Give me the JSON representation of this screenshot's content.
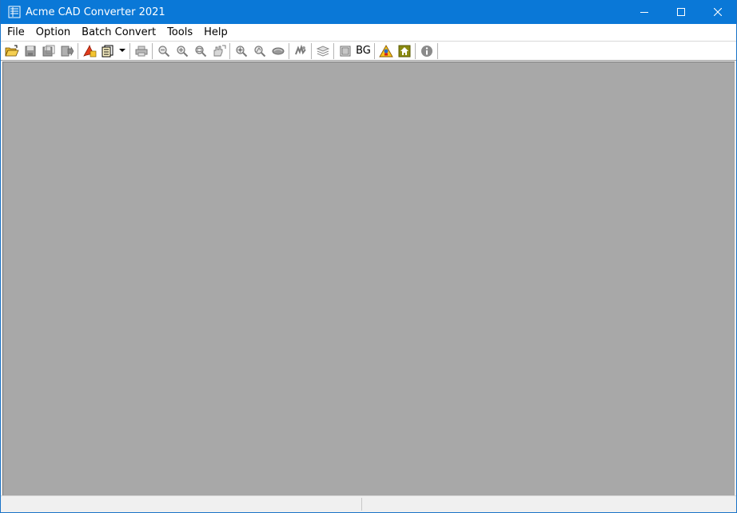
{
  "window": {
    "title": "Acme CAD Converter 2021",
    "accent": "#0a78d7",
    "canvas_color": "#a8a8a8"
  },
  "caption_buttons": [
    {
      "name": "minimize",
      "icon": "minimize-icon"
    },
    {
      "name": "maximize",
      "icon": "maximize-icon"
    },
    {
      "name": "close",
      "icon": "close-icon"
    }
  ],
  "menu": {
    "file": "File",
    "option": "Option",
    "batch_convert": "Batch Convert",
    "tools": "Tools",
    "help": "Help"
  },
  "toolbar": {
    "bg_label": "BG",
    "icons": [
      "open-folder-icon",
      "save-icon",
      "save-all-icon",
      "export-icon",
      "pdf-convert-icon",
      "batch-pages-icon",
      "dropdown-arrow-icon",
      "print-icon",
      "zoom-out-icon",
      "zoom-in-icon",
      "zoom-window-icon",
      "pan-icon",
      "zoom-extents-icon",
      "zoom-realtime-icon",
      "view-icon",
      "redraw-icon",
      "layers-icon",
      "frame-icon",
      "bg-text-icon",
      "warning-icon",
      "home-icon",
      "info-icon"
    ]
  },
  "statusbar": {
    "pane1": "",
    "pane2": ""
  }
}
